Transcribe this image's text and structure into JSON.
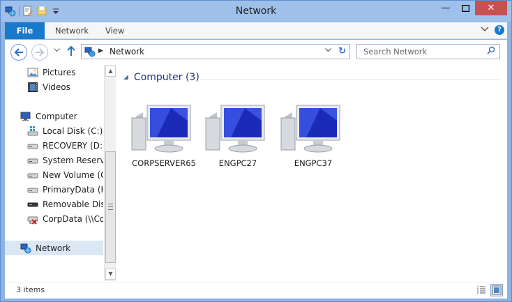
{
  "window": {
    "title": "Network",
    "controls": {
      "minimize": "—",
      "maximize": "☐",
      "close": "✕"
    }
  },
  "ribbon": {
    "tabs": [
      {
        "label": "File"
      },
      {
        "label": "Network"
      },
      {
        "label": "View"
      }
    ]
  },
  "address": {
    "location": "Network",
    "search_placeholder": "Search Network"
  },
  "sidebar": {
    "items": [
      {
        "label": "Pictures",
        "icon": "pictures-icon"
      },
      {
        "label": "Videos",
        "icon": "videos-icon"
      },
      {
        "label": "Computer",
        "icon": "computer-icon"
      },
      {
        "label": "Local Disk (C:)",
        "icon": "windows-drive-icon"
      },
      {
        "label": "RECOVERY (D:)",
        "icon": "drive-icon"
      },
      {
        "label": "System Reserved",
        "icon": "drive-icon"
      },
      {
        "label": "New Volume (G:)",
        "icon": "drive-icon"
      },
      {
        "label": "PrimaryData (H:)",
        "icon": "drive-icon"
      },
      {
        "label": "Removable Disk (",
        "icon": "removable-drive-icon"
      },
      {
        "label": "CorpData (\\\\Corp",
        "icon": "disconnected-network-drive-icon"
      },
      {
        "label": "Network",
        "icon": "network-icon",
        "selected": true
      }
    ]
  },
  "main": {
    "group_header": "Computer (3)",
    "computers": [
      {
        "label": "CORPSERVER65"
      },
      {
        "label": "ENGPC27"
      },
      {
        "label": "ENGPC37"
      }
    ]
  },
  "status": {
    "item_count": "3 items"
  },
  "colors": {
    "titlebar": "#9ec0ea",
    "file_tab": "#1979ca",
    "accent": "#2d6fc4",
    "selection": "#dbe7f4"
  }
}
